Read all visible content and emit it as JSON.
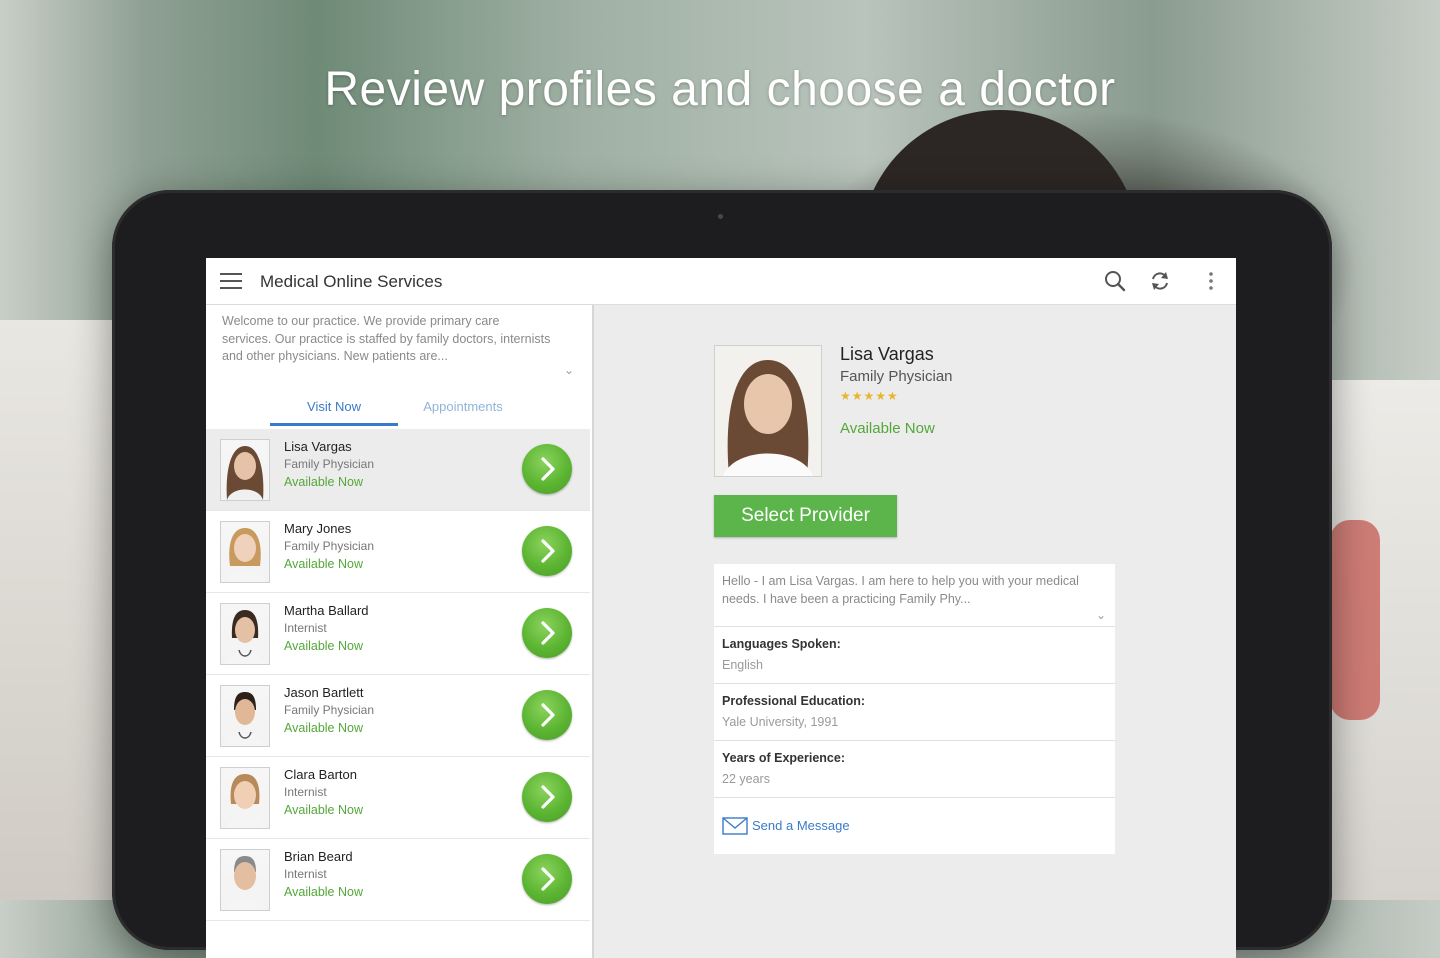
{
  "headline": "Review profiles and choose a doctor",
  "app": {
    "title": "Medical Online Services",
    "icons": [
      "menu-icon",
      "search-icon",
      "refresh-icon",
      "overflow-icon"
    ]
  },
  "intro": "Welcome to our practice. We provide primary care services. Our practice is staffed by family doctors, internists and other physicians. New patients are...",
  "tabs": [
    {
      "label": "Visit Now",
      "active": true
    },
    {
      "label": "Appointments",
      "active": false
    }
  ],
  "doctors": [
    {
      "name": "Lisa Vargas",
      "specialty": "Family Physician",
      "status": "Available Now"
    },
    {
      "name": "Mary Jones",
      "specialty": "Family Physician",
      "status": "Available Now"
    },
    {
      "name": "Martha Ballard",
      "specialty": "Internist",
      "status": "Available Now"
    },
    {
      "name": "Jason Bartlett",
      "specialty": "Family Physician",
      "status": "Available Now"
    },
    {
      "name": "Clara Barton",
      "specialty": "Internist",
      "status": "Available Now"
    },
    {
      "name": "Brian Beard",
      "specialty": "Internist",
      "status": "Available Now"
    }
  ],
  "detail": {
    "name": "Lisa Vargas",
    "specialty": "Family Physician",
    "stars": "★★★★★",
    "rating": 5,
    "status": "Available Now",
    "select_label": "Select Provider",
    "bio": "Hello - I am Lisa Vargas. I am here to help you with your medical needs. I have been a practicing Family Phy...",
    "languages_label": "Languages Spoken:",
    "languages_value": "English",
    "education_label": "Professional Education:",
    "education_value": "Yale University, 1991",
    "experience_label": "Years of Experience:",
    "experience_value": "22 years",
    "message_label": "Send a Message"
  },
  "colors": {
    "accent_green": "#5cb54a",
    "available_green": "#54a83a",
    "link_blue": "#3a7bc8",
    "star_gold": "#e8b52e"
  }
}
